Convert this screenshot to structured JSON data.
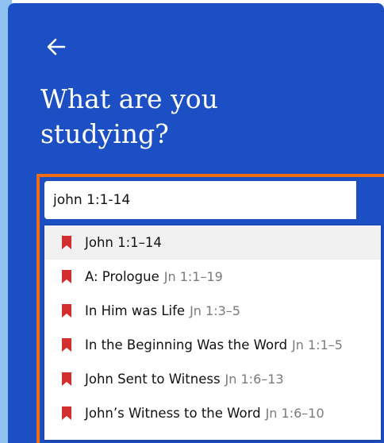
{
  "header": {
    "title": "What are you studying?"
  },
  "search": {
    "value": "john 1:1-14"
  },
  "suggestions": [
    {
      "label": "John 1:1–14",
      "ref": ""
    },
    {
      "label": "A: Prologue",
      "ref": "Jn 1:1–19"
    },
    {
      "label": "In Him was Life",
      "ref": "Jn 1:3–5"
    },
    {
      "label": "In the Beginning Was the Word",
      "ref": "Jn 1:1–5"
    },
    {
      "label": "John Sent to Witness",
      "ref": "Jn 1:6–13"
    },
    {
      "label": "John’s Witness to the Word",
      "ref": "Jn 1:6–10"
    }
  ],
  "colors": {
    "panel": "#1d4fc4",
    "focus": "#f26e13",
    "bookmark": "#d32f2f"
  },
  "icons": {
    "back": "arrow-left-icon",
    "suggestion": "bookmark-icon"
  }
}
